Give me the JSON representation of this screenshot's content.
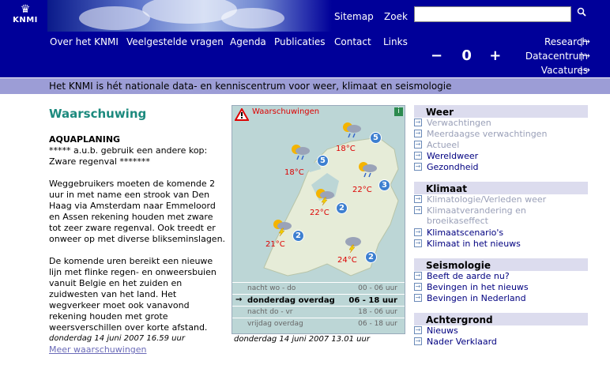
{
  "header": {
    "logo_text": "KNMI",
    "sitemap": "Sitemap",
    "zoek": "Zoek",
    "search_value": "",
    "nav": [
      "Over het KNMI",
      "Veelgestelde vragen",
      "Agenda",
      "Publicaties",
      "Contact",
      "Links"
    ],
    "right_links": [
      "Research",
      "Datacentrum",
      "Vacatures"
    ],
    "zoom": {
      "minus": "−",
      "value": "0",
      "plus": "+"
    },
    "tagline": "Het KNMI is hét nationale data- en kenniscentrum voor weer, klimaat en seismologie"
  },
  "left": {
    "heading": "Waarschuwing",
    "warn_title": "AQUAPLANING",
    "warn_sub": "***** a.u.b. gebruik een andere kop: Zware regenval *******",
    "para1": "Weggebruikers moeten de komende 2 uur in met name een strook van Den Haag via Amsterdam naar Emmeloord en Assen rekening houden met zware tot zeer zware regenval. Ook treedt er onweer op met diverse blikseminslagen.",
    "para2": "De komende uren bereikt een nieuwe lijn met flinke regen- en onweersbuien vanuit Belgie en het zuiden en zuidwesten van het land. Het wegverkeer moet ook vanavond rekening houden met grote weersverschillen over korte afstand.",
    "date": "donderdag 14 juni 2007 16.59 uur",
    "more": "Meer waarschuwingen"
  },
  "map": {
    "title": "Waarschuwingen",
    "info": "i",
    "stations": [
      {
        "temp": "18°C",
        "num": "5"
      },
      {
        "temp": "18°C",
        "num": "5"
      },
      {
        "temp": "22°C",
        "num": "3"
      },
      {
        "temp": "22°C",
        "num": "2"
      },
      {
        "temp": "21°C",
        "num": "2"
      },
      {
        "temp": "24°C",
        "num": "2"
      }
    ],
    "rows": [
      {
        "day": "nacht wo - do",
        "time": "00 - 06 uur"
      },
      {
        "day": "donderdag overdag",
        "time": "06  -  18 uur"
      },
      {
        "day": "nacht do - vr",
        "time": "18 - 06 uur"
      },
      {
        "day": "vrijdag overdag",
        "time": "06 - 18 uur"
      }
    ],
    "selected_arrow": "→",
    "date": "donderdag 14 juni 2007 13.01 uur"
  },
  "sidebar": {
    "weer": {
      "title": "Weer",
      "items": [
        "Verwachtingen",
        "Meerdaagse verwachtingen",
        "Actueel",
        "Wereldweer",
        "Gezondheid"
      ]
    },
    "klimaat": {
      "title": "Klimaat",
      "items": [
        "Klimatologie/Verleden weer",
        "Klimaatverandering en broeikaseffect",
        "Klimaatscenario's",
        "Klimaat in het nieuws"
      ]
    },
    "seismologie": {
      "title": "Seismologie",
      "items": [
        "Beeft de aarde nu?",
        "Bevingen in het nieuws",
        "Bevingen in Nederland"
      ]
    },
    "achtergrond": {
      "title": "Achtergrond",
      "items": [
        "Nieuws",
        "Nader Verklaard"
      ]
    }
  }
}
